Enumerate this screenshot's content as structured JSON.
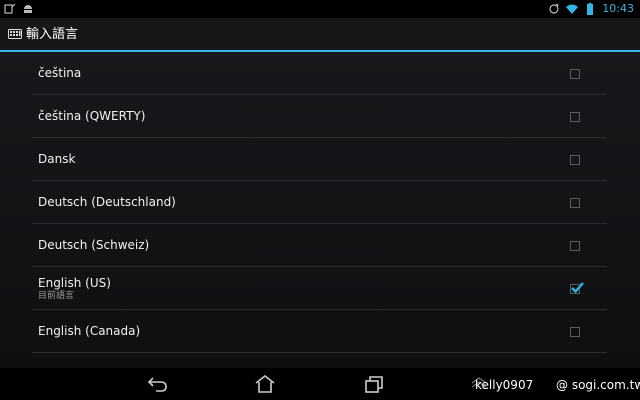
{
  "status_bar": {
    "time": "10:43",
    "left_icons": [
      "screenshot-icon",
      "android-icon"
    ],
    "right_icons": [
      "sync-icon",
      "wifi-icon",
      "battery-icon"
    ],
    "accent": "#33b5e5"
  },
  "action_bar": {
    "icon": "keyboard-icon",
    "title": "輸入語言"
  },
  "languages": [
    {
      "label": "čeština",
      "sublabel": "",
      "checked": false
    },
    {
      "label": "čeština (QWERTY)",
      "sublabel": "",
      "checked": false
    },
    {
      "label": "Dansk",
      "sublabel": "",
      "checked": false
    },
    {
      "label": "Deutsch (Deutschland)",
      "sublabel": "",
      "checked": false
    },
    {
      "label": "Deutsch (Schweiz)",
      "sublabel": "",
      "checked": false
    },
    {
      "label": "English (US)",
      "sublabel": "目前語言",
      "checked": true
    },
    {
      "label": "English (Canada)",
      "sublabel": "",
      "checked": false
    }
  ],
  "nav_bar": {
    "buttons": [
      "back-icon",
      "home-icon",
      "recent-apps-icon"
    ],
    "watermark_user": "kelly0907",
    "watermark_site": "@ sogi.com.tw"
  }
}
